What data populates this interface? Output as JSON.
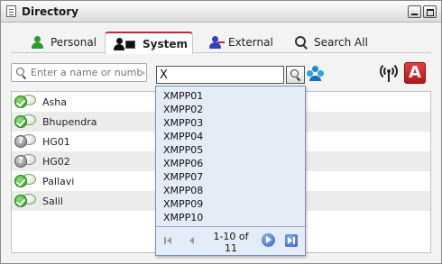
{
  "window": {
    "title": "Directory",
    "icons": {
      "title": "address-book-icon",
      "minimize": "minimize-icon",
      "maximize": "maximize-icon"
    }
  },
  "tabs": [
    {
      "label": "Personal",
      "icon": "person-green-icon",
      "active": false
    },
    {
      "label": "System",
      "icon": "system-directory-icon",
      "active": true
    },
    {
      "label": "External",
      "icon": "external-contact-icon",
      "active": false
    },
    {
      "label": "Search All",
      "icon": "search-icon",
      "active": false
    }
  ],
  "search": {
    "placeholder": "Enter a name or number",
    "value": ""
  },
  "combo": {
    "value": "X"
  },
  "toolbar": {
    "icons": [
      "social-directory-icon",
      "wireless-signal-icon",
      "acrobat-icon"
    ],
    "acrobat_letter": "A"
  },
  "contacts": [
    {
      "name": "Asha",
      "status": "available"
    },
    {
      "name": "Bhupendra",
      "status": "available"
    },
    {
      "name": "HG01",
      "status": "unknown"
    },
    {
      "name": "HG02",
      "status": "unknown"
    },
    {
      "name": "Pallavi",
      "status": "available"
    },
    {
      "name": "Salil",
      "status": "available"
    }
  ],
  "dropdown": {
    "items": [
      "XMPP01",
      "XMPP02",
      "XMPP03",
      "XMPP04",
      "XMPP05",
      "XMPP06",
      "XMPP07",
      "XMPP08",
      "XMPP09",
      "XMPP10"
    ],
    "pager": {
      "range": "1-10 of",
      "total": "11"
    }
  },
  "colors": {
    "active_tab_accent": "#d2232a",
    "dropdown_bg": "#e4ecf7",
    "row_alt": "#ececec"
  }
}
